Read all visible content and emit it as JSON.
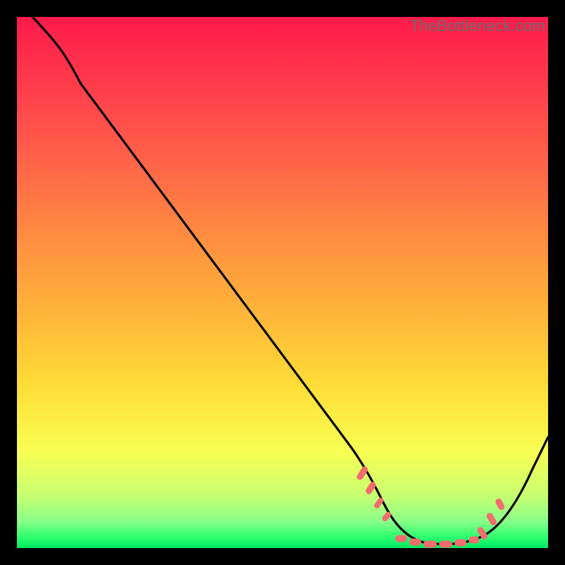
{
  "watermark": "TheBottleneck.com",
  "chart_data": {
    "type": "line",
    "title": "",
    "xlabel": "",
    "ylabel": "",
    "xlim": [
      0,
      100
    ],
    "ylim": [
      0,
      100
    ],
    "x": [
      3,
      10,
      20,
      30,
      40,
      50,
      56,
      60,
      64,
      67,
      70,
      73,
      76,
      80,
      84,
      87,
      90,
      94,
      100
    ],
    "values": [
      100,
      92,
      78,
      63,
      49,
      34,
      25,
      20,
      14,
      10,
      6,
      4,
      2,
      1,
      1,
      2,
      4,
      8,
      18
    ],
    "gradient_colors": [
      "#ff1a4b",
      "#ffbb38",
      "#f8ff54",
      "#00e860"
    ],
    "gradient_direction": "top-to-bottom",
    "marker_cluster": {
      "type": "dashed_segment",
      "x_range": [
        64,
        90
      ],
      "y_range": [
        1,
        14
      ],
      "color": "#f07070"
    }
  }
}
